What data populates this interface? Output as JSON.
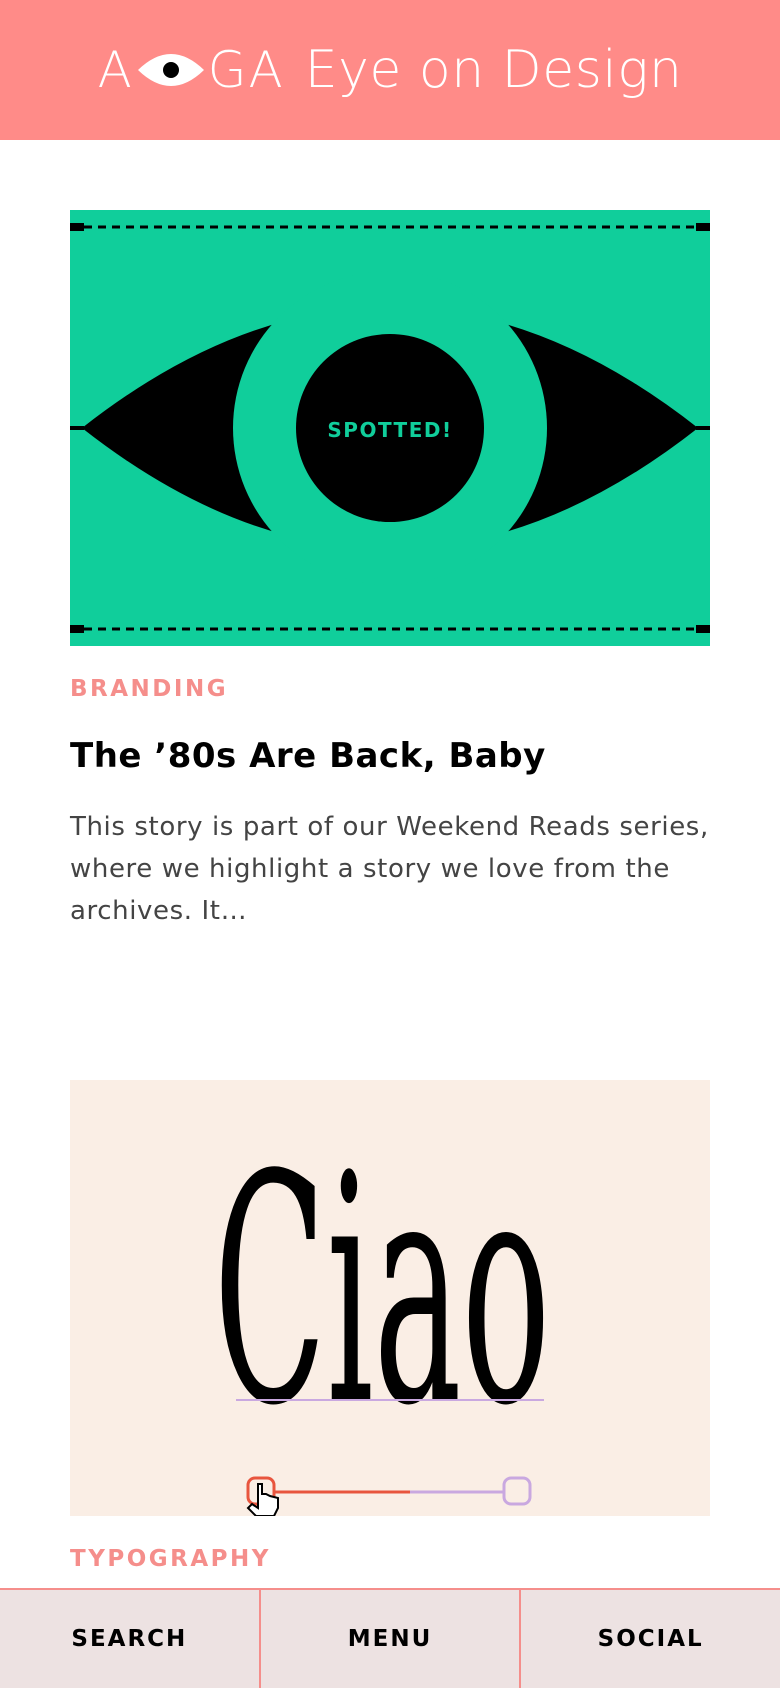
{
  "header": {
    "logo_aiga_left": "A",
    "logo_aiga_right": "GA",
    "logo_text": "Eye on Design",
    "background_color": "#ff8b88"
  },
  "articles": [
    {
      "image": {
        "label": "SPOTTED!",
        "background_color": "#10ce9b",
        "icon": "eye-icon"
      },
      "category": "BRANDING",
      "title": "The ’80s Are Back, Baby",
      "excerpt": "This story is part of our Weekend Reads series, where we highlight a story we love from the archives. It…"
    },
    {
      "image": {
        "word": "Ciao",
        "background_color": "#faeee5",
        "icon": "hand-cursor-icon"
      },
      "category": "TYPOGRAPHY"
    }
  ],
  "bottom_nav": {
    "items": [
      {
        "label": "SEARCH"
      },
      {
        "label": "MENU"
      },
      {
        "label": "SOCIAL"
      }
    ]
  },
  "colors": {
    "accent": "#f58e8b",
    "nav_background": "#ede2e2"
  }
}
